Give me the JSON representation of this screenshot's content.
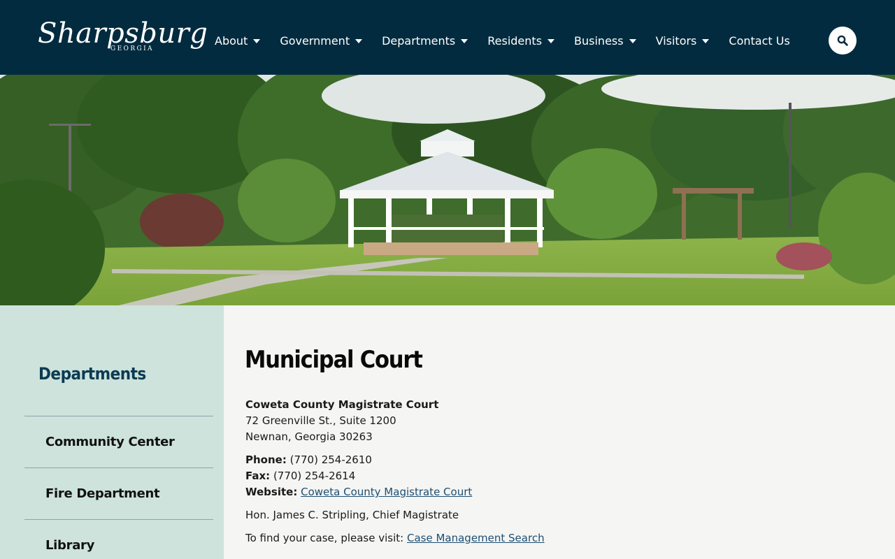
{
  "header": {
    "logo_main": "Sharpsburg",
    "logo_sub": "GEORGIA",
    "nav": [
      {
        "label": "About",
        "dropdown": true
      },
      {
        "label": "Government",
        "dropdown": true
      },
      {
        "label": "Departments",
        "dropdown": true
      },
      {
        "label": "Residents",
        "dropdown": true
      },
      {
        "label": "Business",
        "dropdown": true
      },
      {
        "label": "Visitors",
        "dropdown": true
      },
      {
        "label": "Contact Us",
        "dropdown": false
      }
    ],
    "search_icon": "search-icon"
  },
  "colors": {
    "header_bg": "#032b3f",
    "sidebar_bg": "#cde3dc",
    "sidebar_title": "#0c3a52",
    "link": "#1d4f73",
    "page_bg": "#f5f5f3"
  },
  "sidebar": {
    "title": "Departments",
    "items": [
      {
        "label": "Community Center"
      },
      {
        "label": "Fire Department"
      },
      {
        "label": "Library"
      }
    ]
  },
  "main": {
    "title": "Municipal Court",
    "court_name": "Coweta County Magistrate Court",
    "address_line1": "72 Greenville St., Suite 1200",
    "address_line2": "Newnan, Georgia 30263",
    "phone_label": "Phone:",
    "phone": "(770) 254-2610",
    "fax_label": "Fax:",
    "fax": "(770) 254-2614",
    "website_label": "Website:",
    "website_link": "Coweta County Magistrate Court",
    "magistrate": "Hon. James C. Stripling, Chief Magistrate",
    "case_text": "To find your case, please visit:",
    "case_link": "Case Management Search"
  }
}
